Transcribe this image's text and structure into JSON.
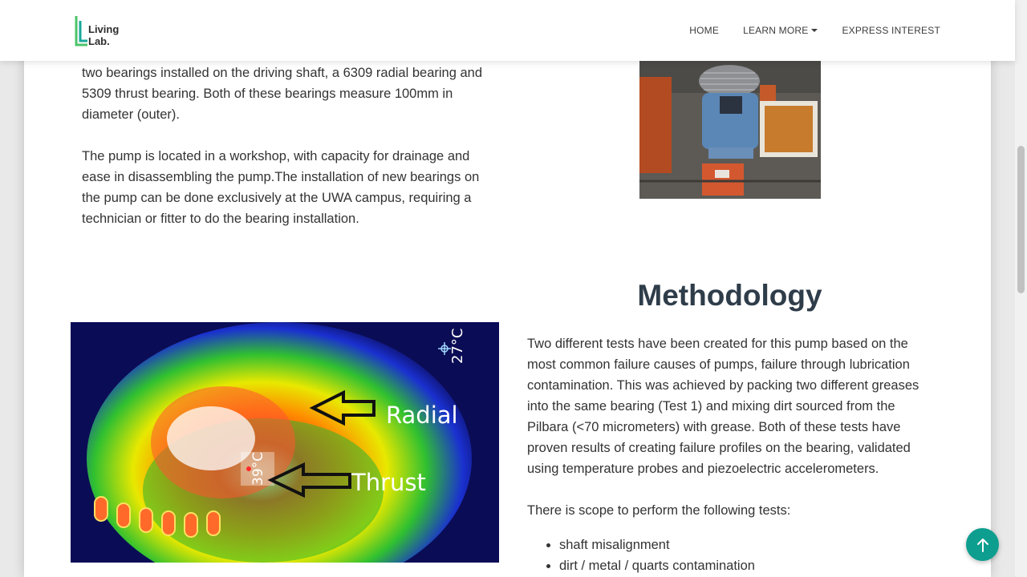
{
  "nav": {
    "logo": {
      "line1": "Living",
      "line2": "Lab."
    },
    "links": [
      {
        "label": "HOME"
      },
      {
        "label": "LEARN MORE"
      },
      {
        "label": "EXPRESS INTEREST"
      }
    ]
  },
  "intro": {
    "paragraph1": "two bearings installed on the driving shaft, a 6309 radial bearing and 5309 thrust bearing. Both of these bearings measure 100mm in diameter (outer).",
    "paragraph2": "The pump is located in a workshop, with capacity for drainage and ease in disassembling the pump.The installation of new bearings on the pump can be done exclusively at the UWA campus, requiring a technician or fitter to do the bearing installation."
  },
  "methodology": {
    "title": "Methodology",
    "paragraph": "Two different tests have been created for this pump based on the most common failure causes of pumps, failure through lubrication contamination. This was achieved by packing two different greases into the same bearing (Test 1) and mixing dirt sourced from the Pilbara (<70 micrometers) with grease. Both of these tests have proven results of creating failure profiles on the bearing, validated using temperature probes and piezoelectric accelerometers.",
    "scope_intro": "There is scope to perform the following tests:",
    "tests": [
      "shaft misalignment",
      "dirt / metal / quarts contamination"
    ]
  },
  "thermal_image": {
    "temp_top": "27°C",
    "temp_spot": "39°C",
    "label_radial": "Radial",
    "label_thrust": "Thrust"
  },
  "colors": {
    "accent": "#0d9e8f",
    "heading": "#2f3d4a",
    "logo_green": "#4cc46a",
    "logo_teal": "#1aa89a"
  },
  "icons": {
    "back_to_top": "arrow-up-icon",
    "dropdown": "caret-down-icon"
  }
}
